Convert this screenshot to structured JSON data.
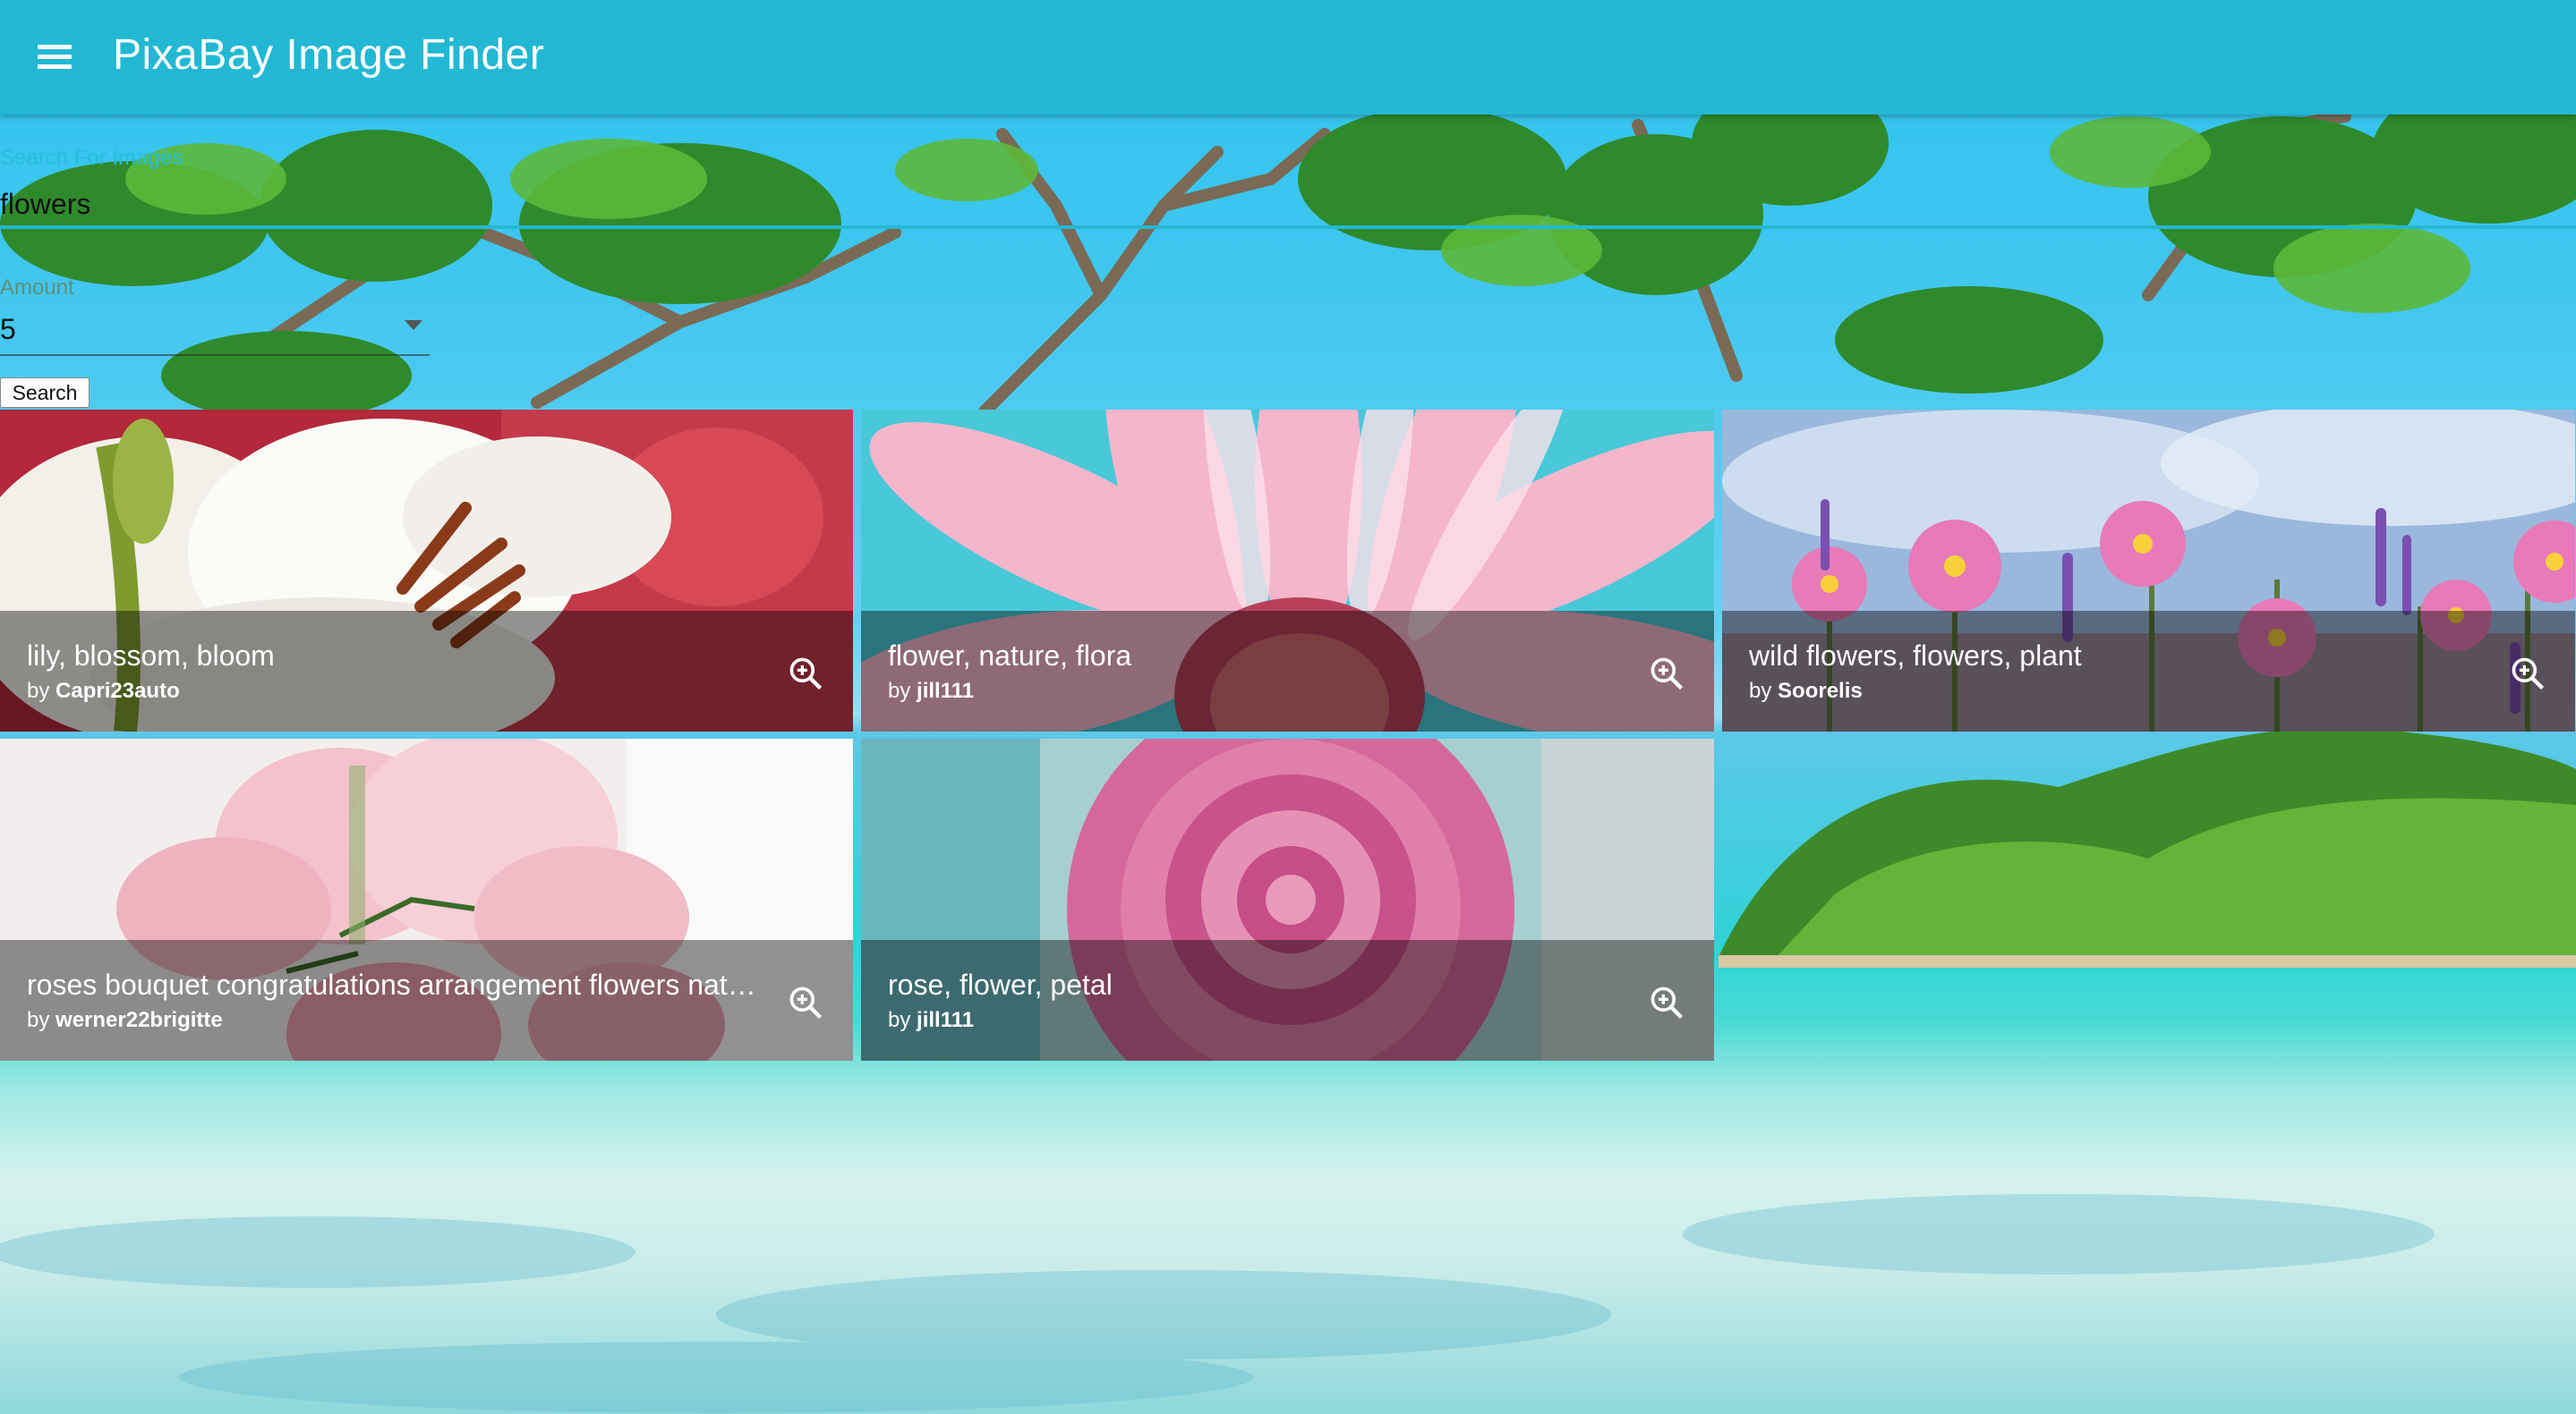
{
  "appbar": {
    "title": "PixaBay Image Finder",
    "menu_icon": "menu-icon",
    "color": "#22b8d4"
  },
  "search": {
    "label": "Search For Images",
    "value": "flowers"
  },
  "amount": {
    "label": "Amount",
    "value": "5"
  },
  "search_button": {
    "label": "Search"
  },
  "images": [
    {
      "title": "lily, blossom, bloom",
      "by_prefix": "by",
      "user": "Capri23auto",
      "zoom_icon": "zoom-in-icon"
    },
    {
      "title": "flower, nature, flora",
      "by_prefix": "by",
      "user": "jill111",
      "zoom_icon": "zoom-in-icon"
    },
    {
      "title": "wild flowers, flowers, plant",
      "by_prefix": "by",
      "user": "Soorelis",
      "zoom_icon": "zoom-in-icon"
    },
    {
      "title": "roses bouquet congratulations arrangement flowers nature",
      "by_prefix": "by",
      "user": "werner22brigitte",
      "zoom_icon": "zoom-in-icon"
    },
    {
      "title": "rose, flower, petal",
      "by_prefix": "by",
      "user": "jill111",
      "zoom_icon": "zoom-in-icon"
    }
  ]
}
